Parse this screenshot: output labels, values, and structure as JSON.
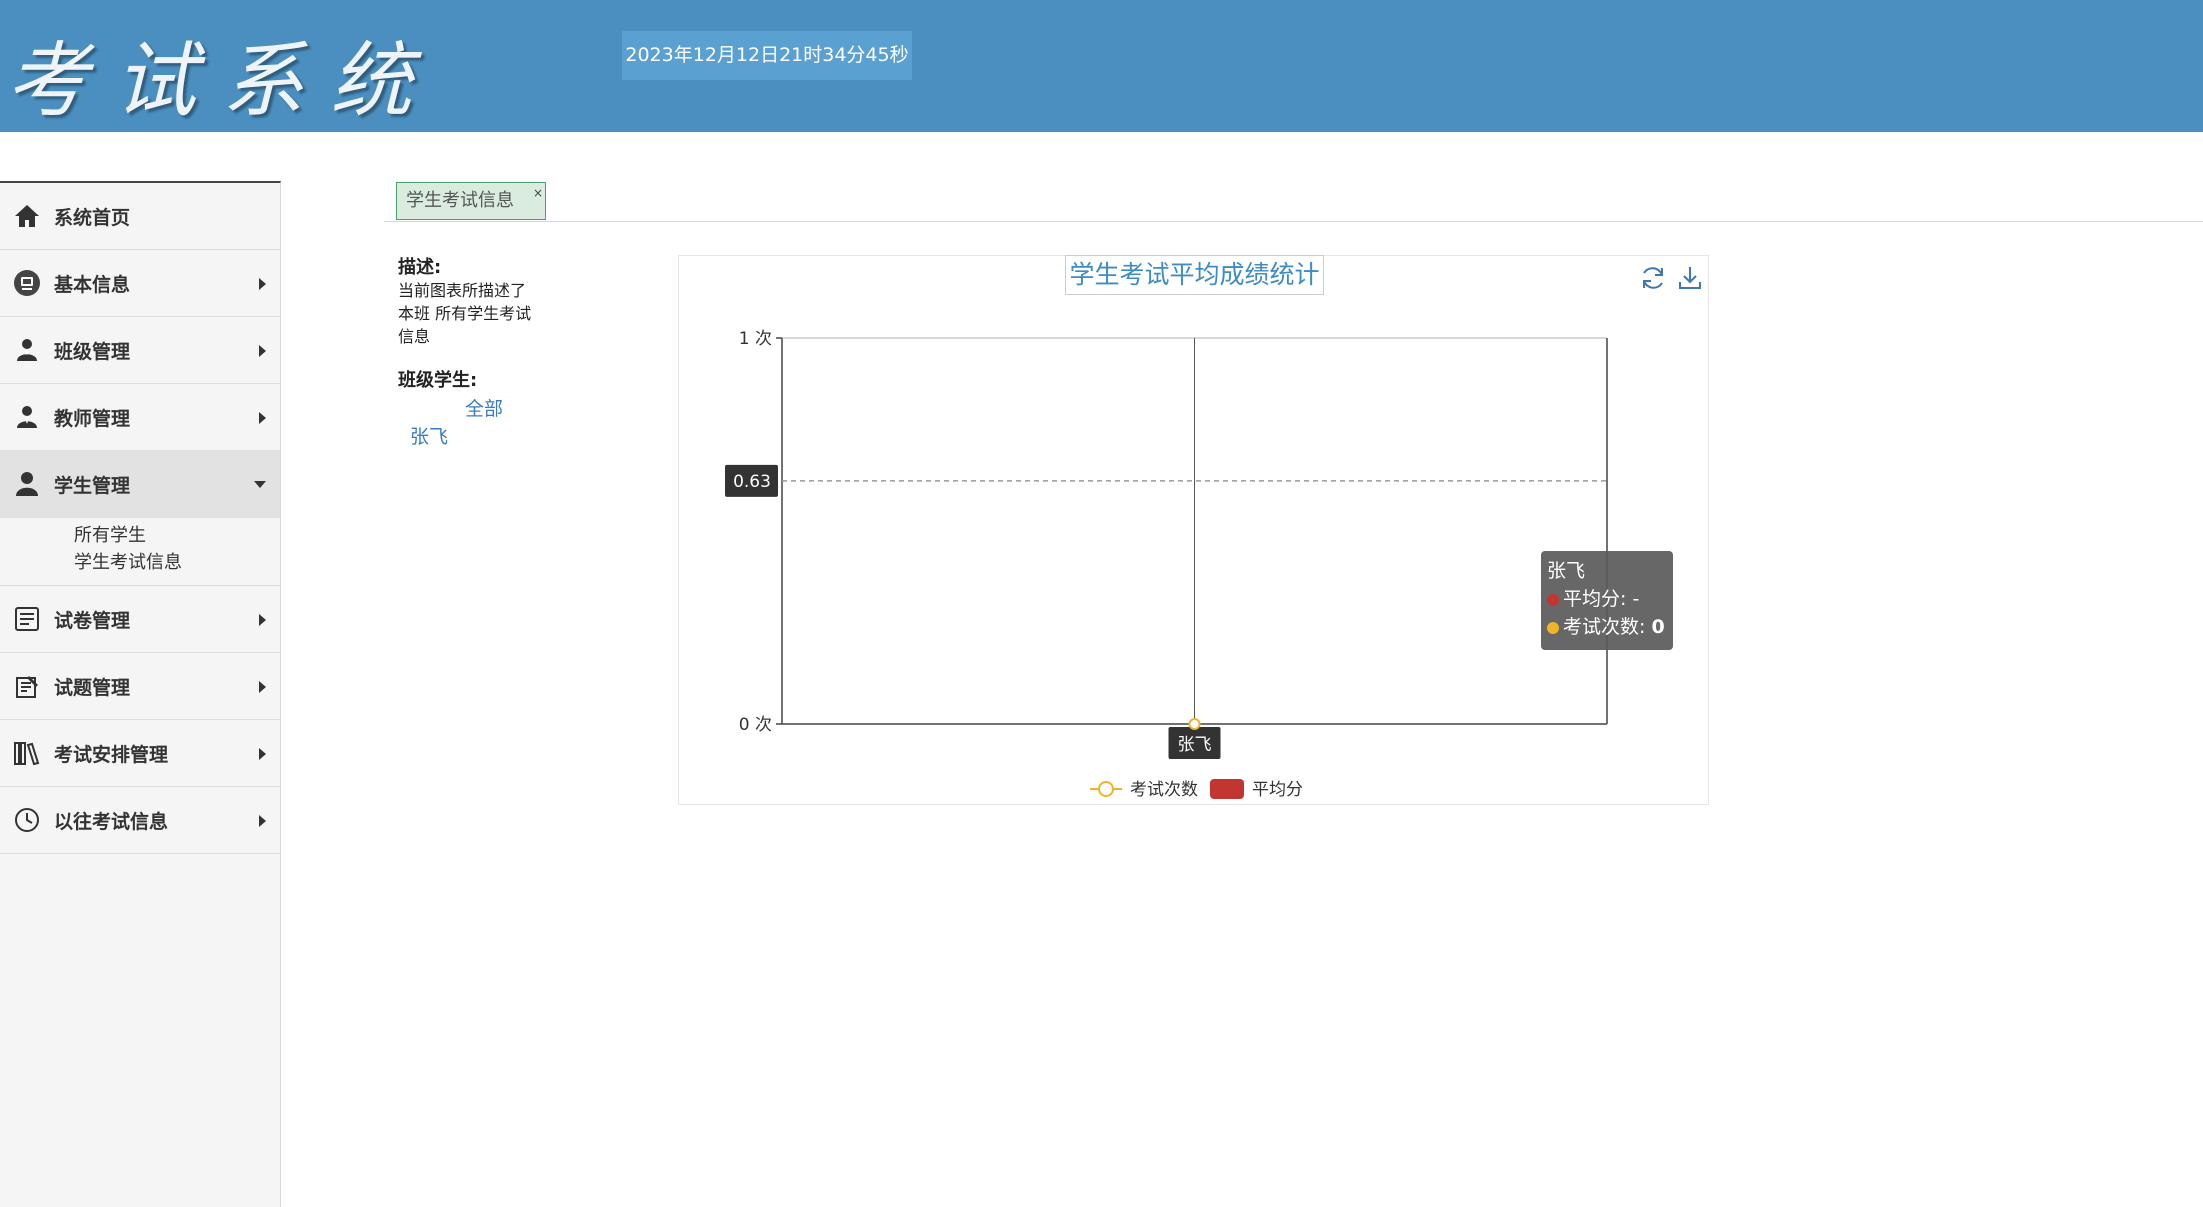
{
  "header": {
    "logo": "考试系统",
    "datetime": "2023年12月12日21时34分45秒"
  },
  "sidebar": {
    "items": [
      {
        "label": "系统首页",
        "icon": "home-icon"
      },
      {
        "label": "基本信息",
        "icon": "monitor-icon"
      },
      {
        "label": "班级管理",
        "icon": "user-group-icon"
      },
      {
        "label": "教师管理",
        "icon": "teacher-icon"
      },
      {
        "label": "学生管理",
        "icon": "student-icon"
      },
      {
        "label": "试卷管理",
        "icon": "paper-icon"
      },
      {
        "label": "试题管理",
        "icon": "question-icon"
      },
      {
        "label": "考试安排管理",
        "icon": "books-icon"
      },
      {
        "label": "以往考试信息",
        "icon": "clock-icon"
      }
    ],
    "submenu": [
      "所有学生",
      "学生考试信息"
    ]
  },
  "tabs": [
    {
      "label": "学生考试信息",
      "close": "×"
    }
  ],
  "description": {
    "title": "描述:",
    "text_line1": "当前图表所描述了",
    "text_line2": "本班 所有学生考试",
    "text_line3": "信息",
    "students_title": "班级学生:",
    "link_all": "全部",
    "link_student": "张飞"
  },
  "chart_data": {
    "type": "line",
    "title": "学生考试平均成绩统计",
    "categories": [
      "张飞"
    ],
    "series": [
      {
        "name": "考试次数",
        "values": [
          0
        ],
        "color": "#f0b429"
      },
      {
        "name": "平均分",
        "values": [
          null
        ],
        "color": "#c23531"
      }
    ],
    "yaxis_ticks": [
      "1 次",
      "0 次"
    ],
    "ylim": [
      0,
      1
    ],
    "axis_pointer_value": "0.63",
    "axis_pointer_label": "张飞",
    "tooltip": {
      "title": "张飞",
      "line1": "平均分: -",
      "line2_label": "考试次数: ",
      "line2_value": "0"
    },
    "legend_position": "bottom-center"
  }
}
